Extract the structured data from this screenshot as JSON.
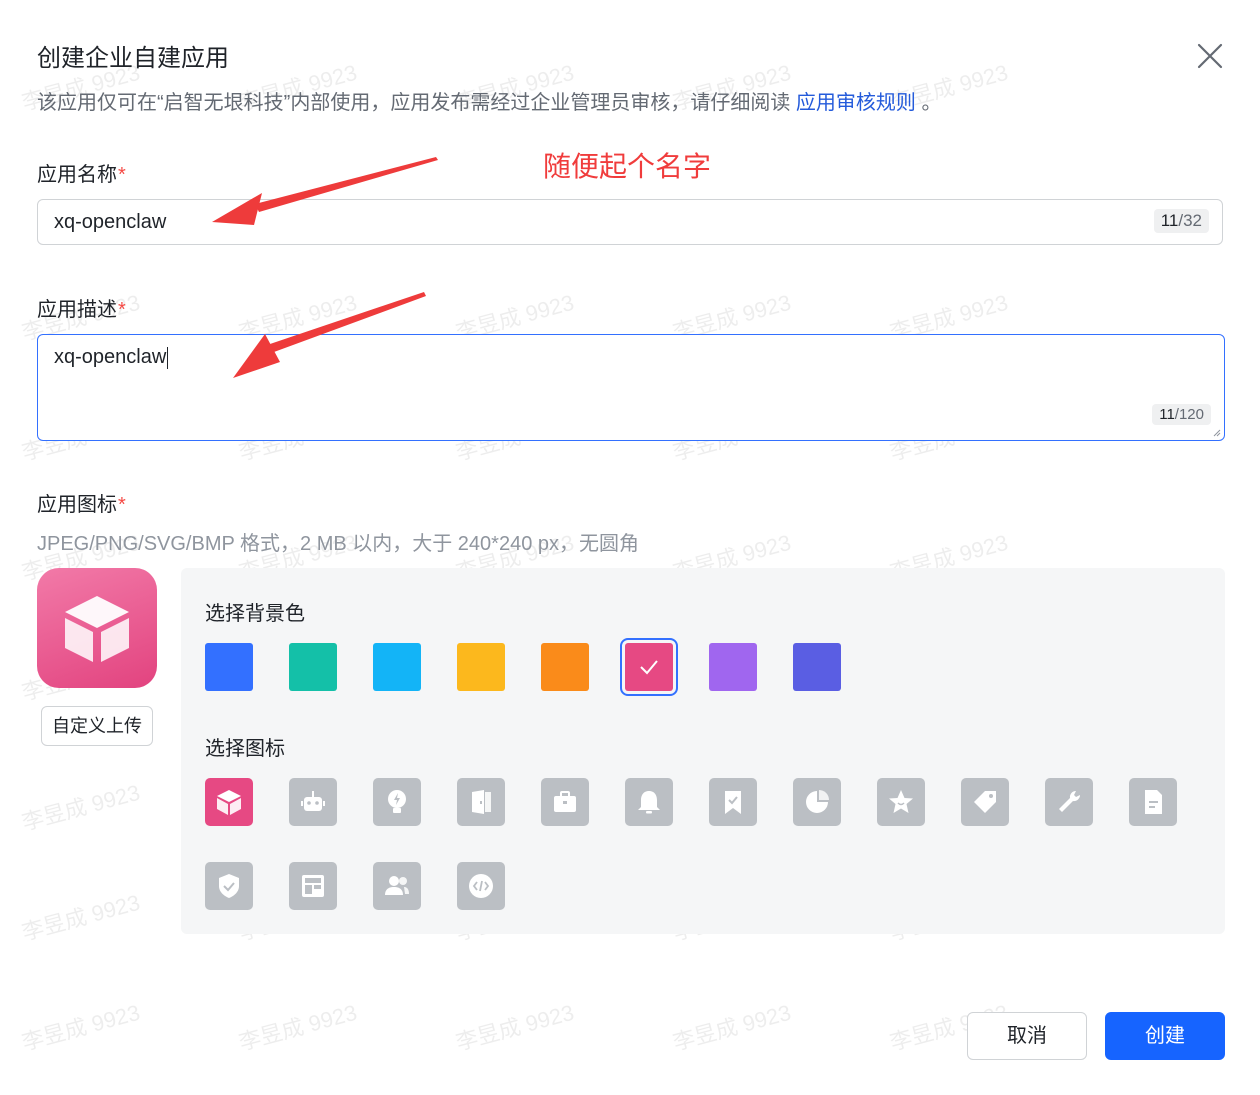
{
  "dialog": {
    "title": "创建企业自建应用",
    "subtitle_prefix": "该应用仅可在“启智无垠科技”内部使用，应用发布需经过企业管理员审核，请仔细阅读 ",
    "subtitle_link": "应用审核规则",
    "subtitle_suffix": " 。"
  },
  "form": {
    "name_label": "应用名称",
    "name_value": "xq-openclaw",
    "name_count": "11",
    "name_max": "/32",
    "desc_label": "应用描述",
    "desc_value": "xq-openclaw",
    "desc_count": "11",
    "desc_max": "/120",
    "icon_label": "应用图标",
    "required_mark": "*",
    "icon_hint": "JPEG/PNG/SVG/BMP 格式，2 MB 以内，大于 240*240 px，无圆角",
    "upload_label": "自定义上传"
  },
  "picker": {
    "bg_label": "选择背景色",
    "icon_label": "选择图标",
    "colors": [
      "#3370ff",
      "#14c0a8",
      "#13b4f7",
      "#fcb81d",
      "#fa8b1a",
      "#e64983",
      "#a066ef",
      "#5a5ee3"
    ],
    "selected_color": 5,
    "icons": [
      "cube-icon",
      "robot-icon",
      "lightbulb-icon",
      "door-icon",
      "briefcase-icon",
      "bell-icon",
      "bookmark-check-icon",
      "pie-chart-icon",
      "star-icon",
      "tag-icon",
      "wrench-icon",
      "document-icon",
      "shield-check-icon",
      "dashboard-icon",
      "users-icon",
      "code-icon"
    ],
    "selected_icon": 0
  },
  "footer": {
    "cancel_label": "取消",
    "create_label": "创建"
  },
  "annotation": {
    "text": "随便起个名字"
  },
  "watermark": "李昱成 9923"
}
